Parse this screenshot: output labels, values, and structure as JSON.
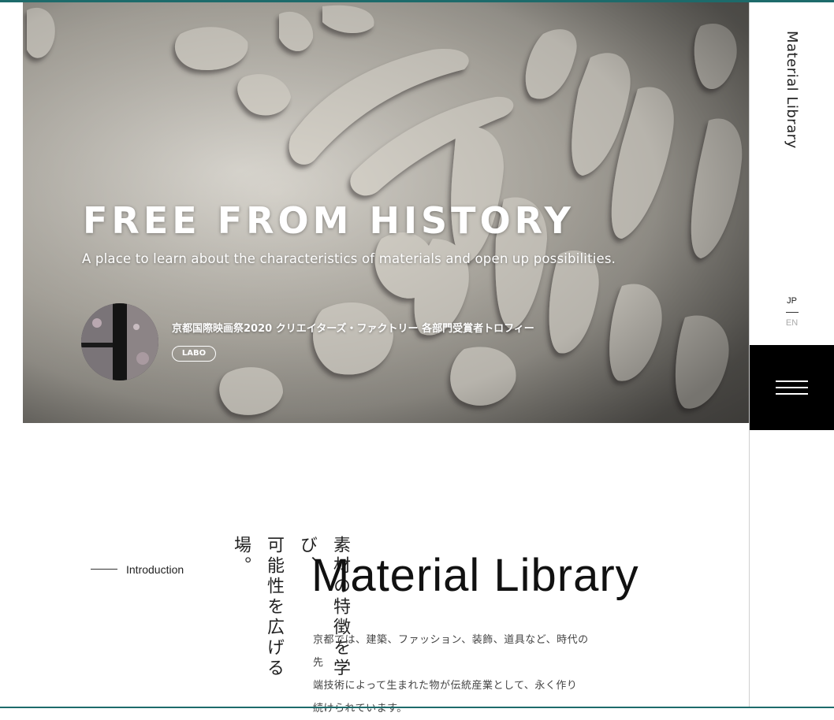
{
  "hero": {
    "title": "FREE FROM HISTORY",
    "subtitle": "A place to learn about the characteristics of materials and open up possibilities.",
    "feature": {
      "title": "京都国際映画祭2020 クリエイターズ・ファクトリー 各部門受賞者トロフィー",
      "tag": "LABO"
    }
  },
  "sidebar": {
    "brand": "Material Library",
    "lang_jp": "JP",
    "lang_en": "EN",
    "menu_icon": "hamburger-menu-icon"
  },
  "intro": {
    "label": "Introduction",
    "heading_col1": "素材の特徴を学び、",
    "heading_col2": "可能性を広げる場。",
    "logo": "Material Library",
    "body_line1": "京都では、建築、ファッション、装飾、道具など、時代の先",
    "body_line2": "端技術によって生まれた物が伝統産業として、永く作り",
    "body_line3": "続けられています。"
  },
  "colors": {
    "accent_line": "#1d6b6b",
    "menu_bg": "#000000",
    "text": "#222222"
  }
}
